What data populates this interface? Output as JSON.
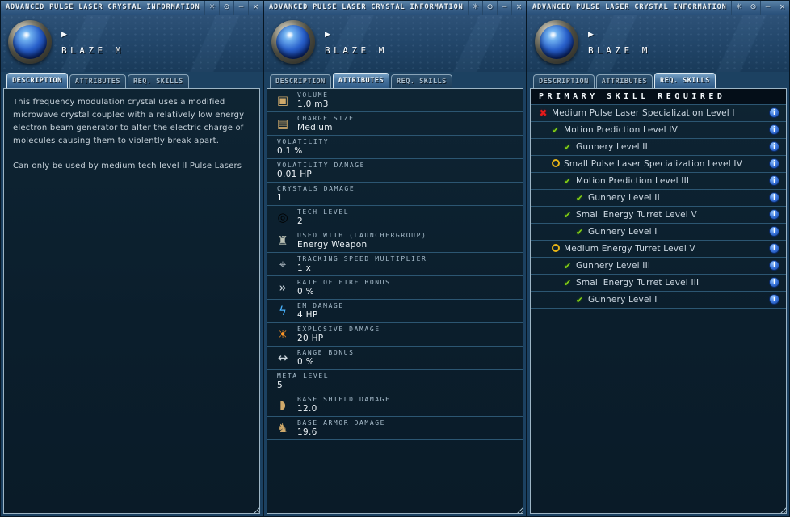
{
  "tabs": [
    "DESCRIPTION",
    "ATTRIBUTES",
    "REQ. SKILLS"
  ],
  "window_controls": [
    {
      "name": "pin",
      "glyph": "✳"
    },
    {
      "name": "dot-circle",
      "glyph": "⊙"
    },
    {
      "name": "minimize",
      "glyph": "−"
    },
    {
      "name": "close",
      "glyph": "×"
    }
  ],
  "status_glyphs": {
    "trained": "✔",
    "untrained": "✖"
  },
  "info_glyph": "i",
  "icon_glyphs": {
    "cube-icon": "▣",
    "charge-icon": "▤",
    "tech-ring-icon": "◎",
    "turret-icon": "♜",
    "tracking-icon": "⌖",
    "rof-icon": "»",
    "em-icon": "ϟ",
    "explosive-icon": "☀",
    "range-icon": "↔",
    "shield-icon": "◗",
    "armor-icon": "♞"
  },
  "colors": {
    "titlebar_blue": "#3a6189",
    "content_bg": "#0b1e2c",
    "trained_green": "#84cc16",
    "untrained_red": "#e21b1b",
    "partial_yellow": "#e7b416",
    "info_blue": "#3a76dd",
    "item_orb_blue": "#2a62cc"
  },
  "windows": [
    {
      "title": "ADVANCED PULSE LASER CRYSTAL INFORMATION",
      "item_name": "BLAZE M",
      "active_tab": "DESCRIPTION",
      "description_paragraphs": [
        "This frequency modulation crystal uses a modified microwave crystal coupled with a relatively low energy electron beam generator to alter the electric charge of molecules causing them to violently break apart.",
        "Can only be used by medium tech level II Pulse Lasers"
      ]
    },
    {
      "title": "ADVANCED PULSE LASER CRYSTAL INFORMATION",
      "item_name": "BLAZE M",
      "active_tab": "ATTRIBUTES",
      "attributes": [
        {
          "label": "VOLUME",
          "value": "1.0 m3",
          "icon": "cube-icon"
        },
        {
          "label": "CHARGE SIZE",
          "value": "Medium",
          "icon": "charge-icon"
        },
        {
          "label": "VOLATILITY",
          "value": "0.1 %",
          "icon": null
        },
        {
          "label": "VOLATILITY DAMAGE",
          "value": "0.01 HP",
          "icon": null
        },
        {
          "label": "CRYSTALS DAMAGE",
          "value": "1",
          "icon": null
        },
        {
          "label": "TECH LEVEL",
          "value": "2",
          "icon": "tech-ring-icon"
        },
        {
          "label": "USED WITH (LAUNCHERGROUP)",
          "value": "Energy Weapon",
          "icon": "turret-icon"
        },
        {
          "label": "TRACKING SPEED MULTIPLIER",
          "value": "1 x",
          "icon": "tracking-icon"
        },
        {
          "label": "RATE OF FIRE BONUS",
          "value": "0 %",
          "icon": "rof-icon"
        },
        {
          "label": "EM DAMAGE",
          "value": "4 HP",
          "icon": "em-icon"
        },
        {
          "label": "EXPLOSIVE DAMAGE",
          "value": "20 HP",
          "icon": "explosive-icon"
        },
        {
          "label": "RANGE BONUS",
          "value": "0 %",
          "icon": "range-icon"
        },
        {
          "label": "META LEVEL",
          "value": "5",
          "icon": null
        },
        {
          "label": "BASE SHIELD DAMAGE",
          "value": "12.0",
          "icon": "shield-icon"
        },
        {
          "label": "BASE ARMOR DAMAGE",
          "value": "19.6",
          "icon": "armor-icon"
        }
      ]
    },
    {
      "title": "ADVANCED PULSE LASER CRYSTAL INFORMATION",
      "item_name": "BLAZE M",
      "active_tab": "REQ. SKILLS",
      "skills_header": "PRIMARY SKILL REQUIRED",
      "skills": [
        {
          "name": "Medium Pulse Laser Specialization Level I",
          "indent": 0,
          "status": "untrained"
        },
        {
          "name": "Motion Prediction Level IV",
          "indent": 1,
          "status": "trained"
        },
        {
          "name": "Gunnery Level II",
          "indent": 2,
          "status": "trained"
        },
        {
          "name": "Small Pulse Laser Specialization Level IV",
          "indent": 1,
          "status": "partial"
        },
        {
          "name": "Motion Prediction Level III",
          "indent": 2,
          "status": "trained"
        },
        {
          "name": "Gunnery Level II",
          "indent": 3,
          "status": "trained"
        },
        {
          "name": "Small Energy Turret Level V",
          "indent": 2,
          "status": "trained"
        },
        {
          "name": "Gunnery Level I",
          "indent": 3,
          "status": "trained"
        },
        {
          "name": "Medium Energy Turret Level V",
          "indent": 1,
          "status": "partial"
        },
        {
          "name": "Gunnery Level III",
          "indent": 2,
          "status": "trained"
        },
        {
          "name": "Small Energy Turret Level III",
          "indent": 2,
          "status": "trained"
        },
        {
          "name": "Gunnery Level I",
          "indent": 3,
          "status": "trained"
        }
      ]
    }
  ]
}
